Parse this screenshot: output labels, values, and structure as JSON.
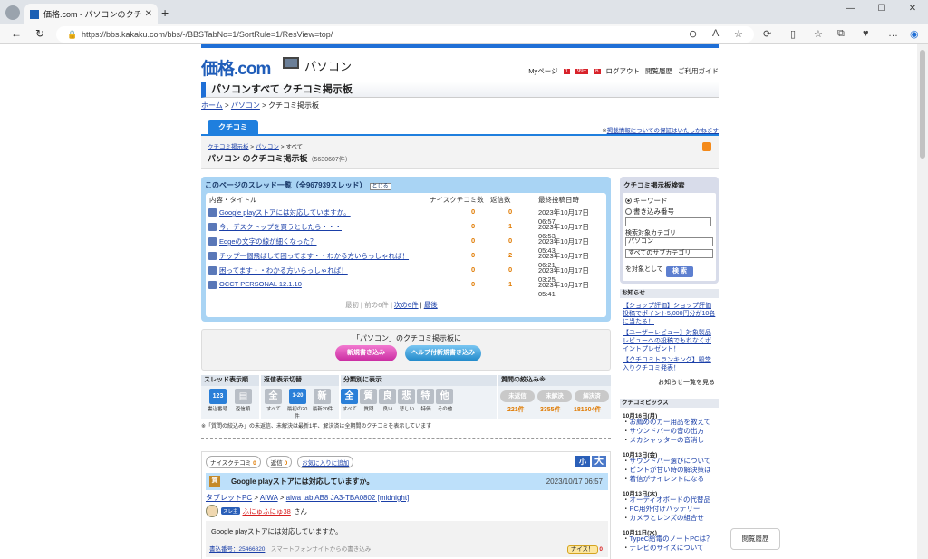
{
  "browser": {
    "tab_title": "価格.com - パソコンのクチコミ掲示板",
    "tab_close": "✕",
    "new_tab": "+",
    "url": "https://bbs.kakaku.com/bbs/-/BBSTabNo=1/SortRule=1/ResView=top/",
    "window_controls": [
      "—",
      "☐",
      "✕"
    ]
  },
  "header": {
    "logo": "価格.com",
    "section": "パソコン",
    "nav": {
      "mypage": "Myページ",
      "badge1": "1",
      "badge2": "99+",
      "badge3": "6",
      "logout": "ログアウト",
      "history": "閲覧履歴",
      "guide": "ご利用ガイド"
    },
    "page_title": "パソコンすべて クチコミ掲示板",
    "breadcrumb": [
      "ホーム",
      "パソコン",
      "クチコミ掲示板"
    ]
  },
  "tabs": {
    "kuchikomi": "クチコミ",
    "notice": "掲載情報についての保証はいたしかねます"
  },
  "forum": {
    "crumb": [
      "クチコミ掲示板",
      "パソコン",
      "すべて"
    ],
    "title": "パソコン のクチコミ掲示板",
    "count": "（5630607件）"
  },
  "thread_list": {
    "heading": "このページのスレッド一覧（全967939スレッド）",
    "close_label": "とじる",
    "columns": [
      "内容・タイトル",
      "ナイスクチコミ数",
      "返信数",
      "最終投稿日時"
    ],
    "rows": [
      {
        "title": "Google playストアには対応していますか。",
        "nice": "0",
        "replies": "0",
        "date": "2023年10月17日 06:57"
      },
      {
        "title": "今、デスクトップを買うとしたら・・・",
        "nice": "0",
        "replies": "1",
        "date": "2023年10月17日 06:53"
      },
      {
        "title": "Edgeの文字の線が細くなった？",
        "nice": "0",
        "replies": "0",
        "date": "2023年10月17日 05:43"
      },
      {
        "title": "チップ一個飛ばして困ってます・・わかる方いらっしゃれば！",
        "nice": "0",
        "replies": "2",
        "date": "2023年10月17日 06:21"
      },
      {
        "title": "困ってます・・わかる方いらっしゃれば！",
        "nice": "0",
        "replies": "0",
        "date": "2023年10月17日 03:25"
      },
      {
        "title": "OCCT PERSONAL 12.1.10",
        "nice": "0",
        "replies": "1",
        "date": "2023年10月17日 05:41"
      }
    ],
    "pager": {
      "first": "最初",
      "prev": "前の6件",
      "next": "次の6件",
      "last": "最後"
    }
  },
  "newpost": {
    "label": "「パソコン」のクチコミ掲示板に",
    "new_button": "新規書き込み",
    "help_button": "ヘルプ付新規書き込み"
  },
  "filters": {
    "g1": {
      "label": "スレッド表示順",
      "b1": "123",
      "c1": "書込番号",
      "c2": "返信順"
    },
    "g2": {
      "label": "返信表示切替",
      "b1": "全",
      "b2": "1-20",
      "b3": "新",
      "c1": "すべて",
      "c2": "最初の20件",
      "c3": "最新20件"
    },
    "g3": {
      "label": "分類別に表示",
      "buttons": [
        "全",
        "質",
        "良",
        "悲",
        "特",
        "他"
      ],
      "caps": [
        "すべて",
        "質問",
        "良い",
        "悲しい",
        "特価",
        "その他"
      ]
    },
    "g4": {
      "label": "質問の絞込み※",
      "p1": "未返信",
      "p2": "未解決",
      "p3": "解決済",
      "n1": "221件",
      "n2": "3355件",
      "n3": "181504件"
    },
    "note": "※「質問の絞込み」の未返信、未解決は最新1年、解決済は全期間のクチコミを表示しています"
  },
  "post": {
    "nice_label": "ナイスクチコミ",
    "nice_count": "0",
    "reply_label": "返信",
    "reply_count": "0",
    "fav_label": "お気に入りに追加",
    "font_small": "小",
    "font_big": "大",
    "badge": "質",
    "title": "Google playストアには対応していますか。",
    "date": "2023/10/17 06:57",
    "prod_crumb": [
      "タブレットPC",
      "AIWA",
      "aiwa tab AB8 JA3-TBA0802 [midnight]"
    ],
    "user_badge": "スレ主",
    "user_name": "ふにゅふにゅ38",
    "user_suffix": "さん",
    "body": "Google playストアには対応していますか。",
    "post_no": "書込番号：25466820",
    "via": "スマートフォンサイトからの書き込み",
    "nice_btn": "ナイス！",
    "nice_btn_count": "0"
  },
  "sidebar": {
    "search": {
      "title": "クチコミ掲示板検索",
      "opt1": "キーワード",
      "opt2": "書き込み番号",
      "cat_label": "検索対象カテゴリ",
      "cat_value": "パソコン",
      "subcat_value": "すべてのサブカテゴリ",
      "target": "を対象として",
      "button": "検 索"
    },
    "notice_head": "お知らせ",
    "notices": [
      "【ショップ評価】ショップ評価投稿でポイント5,000円分が10名に当たる！",
      "【ユーザーレビュー】対象製品レビューへの投稿でもれなくポイントプレゼント！",
      "【クチコミトランキング】殿堂入りクチコミ発表！"
    ],
    "notice_more": "お知らせ一覧を見る",
    "topics_head": "クチコミピックス",
    "topics": [
      {
        "day": "10月16日(月)",
        "items": [
          "お薦めのカー用品を教えて",
          "サウンドバーの音の出方",
          "メカシャッターの音消し"
        ]
      },
      {
        "day": "10月13日(金)",
        "items": [
          "サウンドバー選びについて",
          "ピントが甘い時の解決策は",
          "着信がサイレントになる"
        ]
      },
      {
        "day": "10月13日(木)",
        "items": [
          "オーディオボードの代替品",
          "PC用外付けバッテリー",
          "カメラとレンズの組合せ"
        ]
      },
      {
        "day": "10月11日(水)",
        "items": [
          "TypeC給電のノートPCは？",
          "テレビのサイズについて"
        ]
      }
    ]
  },
  "floating": {
    "history": "閲覧履歴"
  }
}
